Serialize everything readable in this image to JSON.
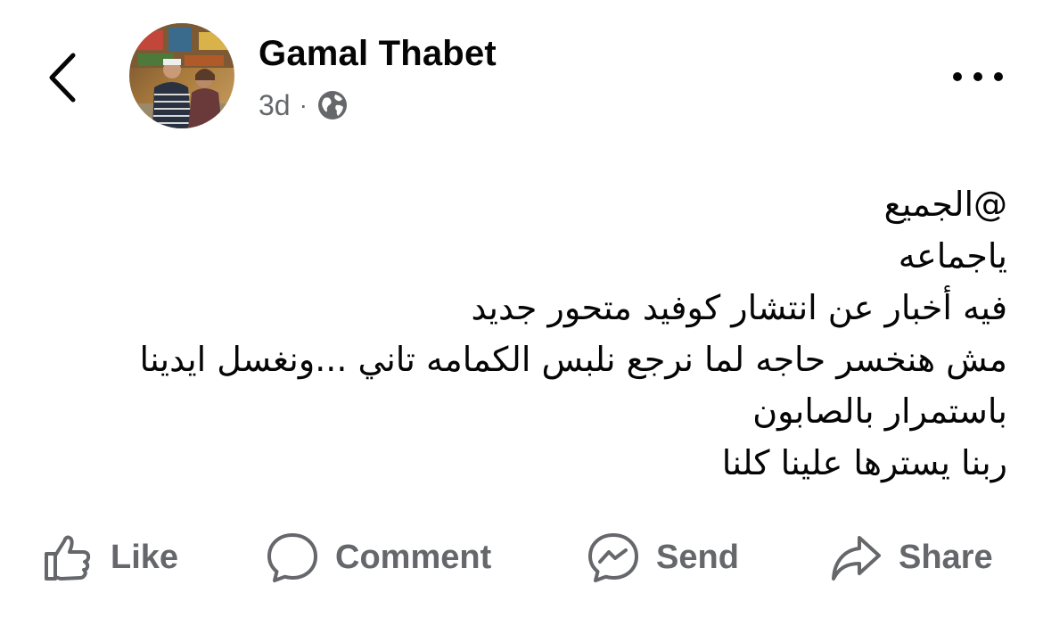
{
  "post": {
    "author": "Gamal Thabet",
    "time": "3d",
    "separator": "·",
    "privacy_icon": "globe-icon",
    "lines": [
      "@الجميع",
      "ياجماعه",
      "فيه أخبار عن انتشار كوفيد متحور جديد",
      "مش هنخسر حاجه لما نرجع نلبس الكمامه تاني ...ونغسل ايدينا",
      "باستمرار بالصابون",
      "ربنا يسترها علينا كلنا"
    ]
  },
  "header": {
    "back_icon": "chevron-left-icon",
    "more_icon": "more-dots-icon"
  },
  "actions": {
    "like": "Like",
    "comment": "Comment",
    "send": "Send",
    "share": "Share"
  },
  "colors": {
    "text": "#050505",
    "secondary": "#65676b",
    "background": "#ffffff"
  }
}
